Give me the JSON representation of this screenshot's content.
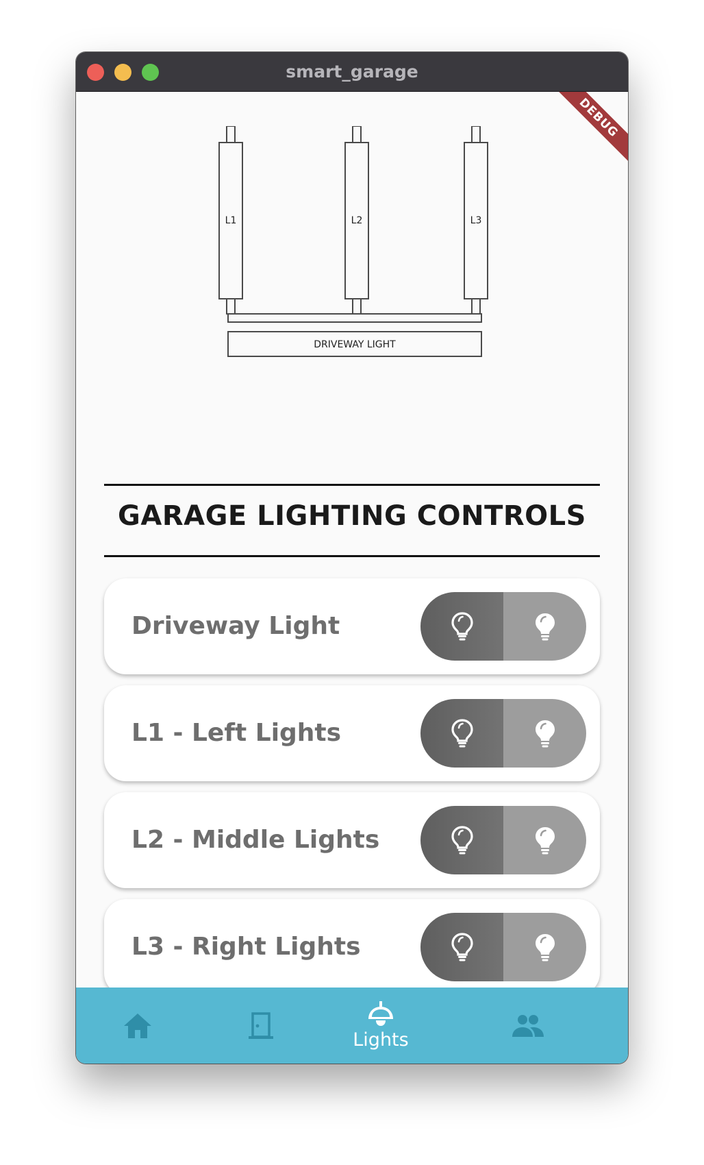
{
  "window": {
    "title": "smart_garage",
    "debug_banner": "DEBUG"
  },
  "diagram": {
    "lights": [
      "L1",
      "L2",
      "L3"
    ],
    "driveway_label": "DRIVEWAY LIGHT"
  },
  "section": {
    "heading": "GARAGE LIGHTING CONTROLS"
  },
  "controls": [
    {
      "label": "Driveway Light",
      "on_icon": "lightbulb-outline-icon",
      "off_icon": "lightbulb-filled-icon"
    },
    {
      "label": "L1 - Left Lights",
      "on_icon": "lightbulb-outline-icon",
      "off_icon": "lightbulb-filled-icon"
    },
    {
      "label": "L2 - Middle Lights",
      "on_icon": "lightbulb-outline-icon",
      "off_icon": "lightbulb-filled-icon"
    },
    {
      "label": "L3 - Right Lights",
      "on_icon": "lightbulb-outline-icon",
      "off_icon": "lightbulb-filled-icon"
    }
  ],
  "bottom_nav": {
    "items": [
      {
        "icon": "home-icon",
        "label": ""
      },
      {
        "icon": "door-icon",
        "label": ""
      },
      {
        "icon": "ceiling-light-icon",
        "label": "Lights",
        "selected": true
      },
      {
        "icon": "people-icon",
        "label": ""
      }
    ]
  },
  "colors": {
    "nav_background": "#56b8d2",
    "nav_icon_inactive": "#2f8ea8",
    "toggle_on": "#666666",
    "toggle_off": "#9d9d9d",
    "debug_ribbon": "#a23a3c"
  }
}
